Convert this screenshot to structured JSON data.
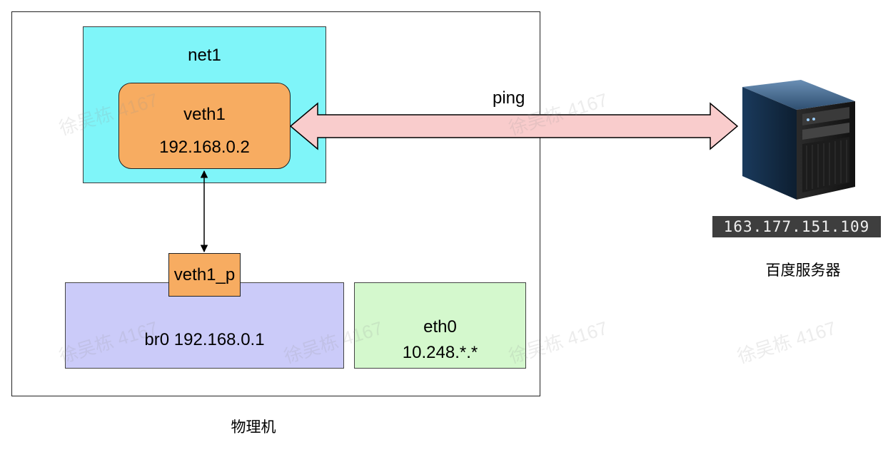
{
  "diagram": {
    "physical_machine": {
      "label": "物理机"
    },
    "net1": {
      "label": "net1"
    },
    "veth1": {
      "name": "veth1",
      "ip": "192.168.0.2"
    },
    "veth1_p": {
      "label": "veth1_p"
    },
    "br0": {
      "label": "br0 192.168.0.1"
    },
    "eth0": {
      "name": "eth0",
      "ip": "10.248.*.*"
    },
    "ping": {
      "label": "ping"
    },
    "server": {
      "ip": "163.177.151.109",
      "label": "百度服务器",
      "icon": "server-tower-icon"
    },
    "watermark": "徐吴栋 4167"
  },
  "colors": {
    "net1_fill": "#7ff5f9",
    "veth_fill": "#f7ac61",
    "br0_fill": "#cbcbf9",
    "eth0_fill": "#d4f8cd",
    "ping_arrow_fill": "#f9cccc",
    "ping_arrow_stroke": "#b85450"
  }
}
